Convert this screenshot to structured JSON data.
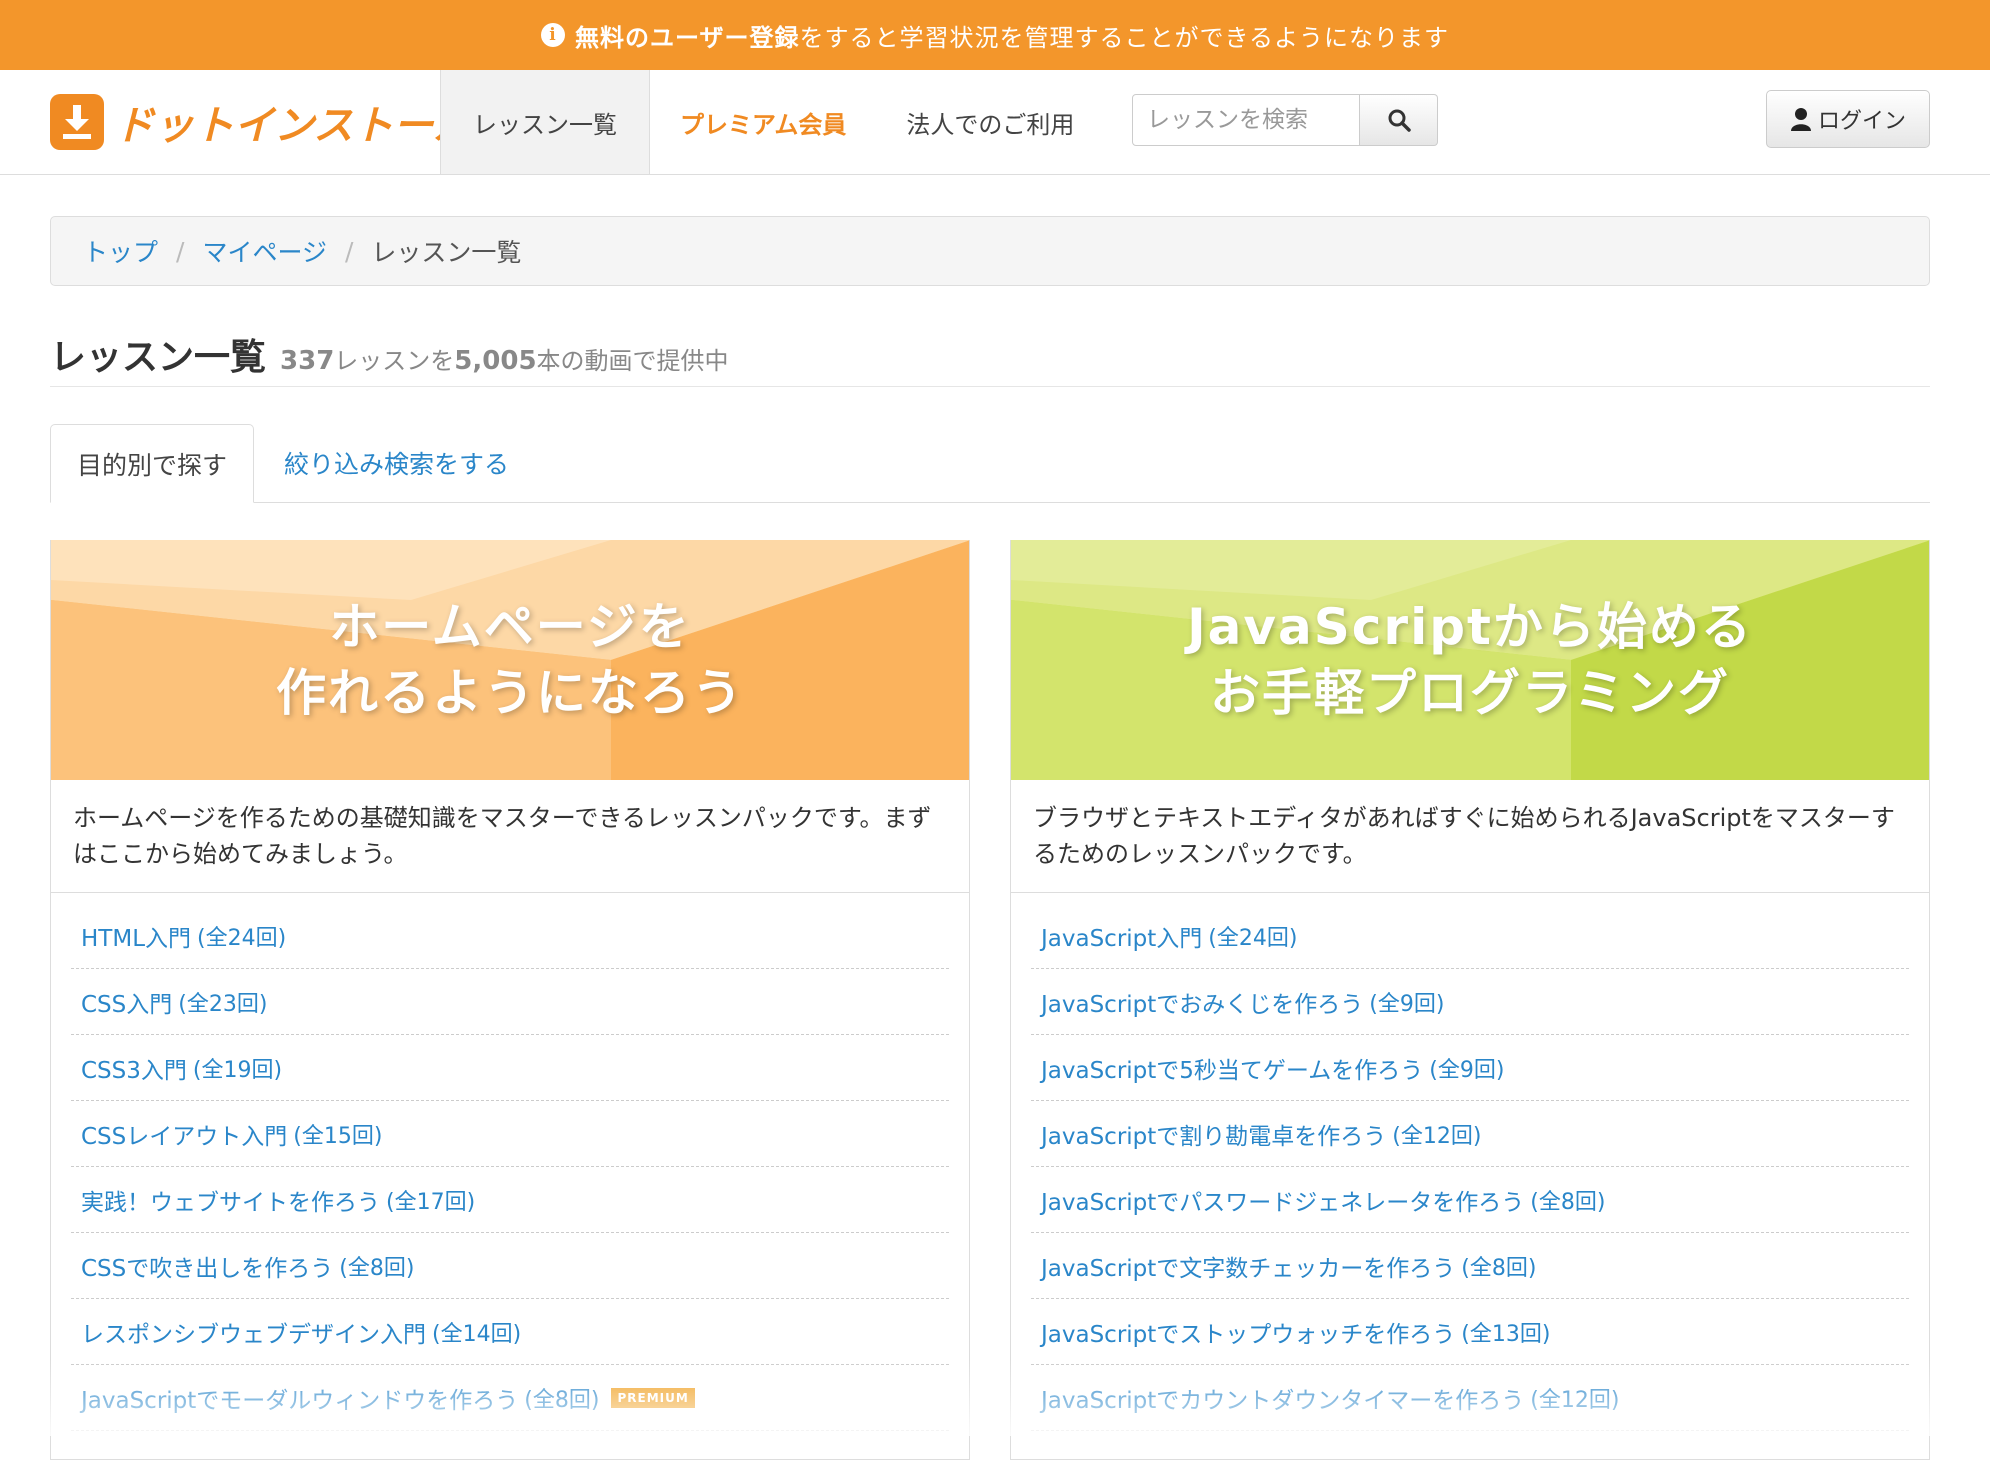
{
  "banner": {
    "strong": "無料のユーザー登録",
    "rest": "をすると学習状況を管理することができるようになります"
  },
  "header": {
    "logo_text": "ドットインストール",
    "nav": [
      {
        "label": "レッスン一覧"
      },
      {
        "label": "プレミアム会員"
      },
      {
        "label": "法人でのご利用"
      }
    ],
    "search_placeholder": "レッスンを検索",
    "login_label": "ログイン"
  },
  "breadcrumb": {
    "items": [
      "トップ",
      "マイページ",
      "レッスン一覧"
    ],
    "separator": "/"
  },
  "page": {
    "title": "レッスン一覧",
    "lesson_count": "337",
    "lesson_count_suffix": "レッスンを",
    "video_count": "5,005",
    "video_count_suffix": "本の動画で提供中"
  },
  "tabs": [
    {
      "label": "目的別で探す"
    },
    {
      "label": "絞り込み検索をする"
    }
  ],
  "packs": [
    {
      "hero_line1": "ホームページを",
      "hero_line2": "作れるようになろう",
      "description": "ホームページを作るための基礎知識をマスターできるレッスンパックです。まずはここから始めてみましょう。",
      "lessons": [
        {
          "title": "HTML入門",
          "count": "(全24回)"
        },
        {
          "title": "CSS入門",
          "count": "(全23回)"
        },
        {
          "title": "CSS3入門",
          "count": "(全19回)"
        },
        {
          "title": "CSSレイアウト入門",
          "count": "(全15回)"
        },
        {
          "title": "実践！ウェブサイトを作ろう",
          "count": "(全17回)"
        },
        {
          "title": "CSSで吹き出しを作ろう",
          "count": "(全8回)"
        },
        {
          "title": "レスポンシブウェブデザイン入門",
          "count": "(全14回)"
        },
        {
          "title": "JavaScriptでモーダルウィンドウを作ろう",
          "count": "(全8回)",
          "badge": "PREMIUM"
        }
      ]
    },
    {
      "hero_line1": "JavaScriptから始める",
      "hero_line2": "お手軽プログラミング",
      "description": "ブラウザとテキストエディタがあればすぐに始められるJavaScriptをマスターするためのレッスンパックです。",
      "lessons": [
        {
          "title": "JavaScript入門",
          "count": "(全24回)"
        },
        {
          "title": "JavaScriptでおみくじを作ろう",
          "count": "(全9回)"
        },
        {
          "title": "JavaScriptで5秒当てゲームを作ろう",
          "count": "(全9回)"
        },
        {
          "title": "JavaScriptで割り勘電卓を作ろう",
          "count": "(全12回)"
        },
        {
          "title": "JavaScriptでパスワードジェネレータを作ろう",
          "count": "(全8回)"
        },
        {
          "title": "JavaScriptで文字数チェッカーを作ろう",
          "count": "(全8回)"
        },
        {
          "title": "JavaScriptでストップウォッチを作ろう",
          "count": "(全13回)"
        },
        {
          "title": "JavaScriptでカウントダウンタイマーを作ろう",
          "count": "(全12回)"
        }
      ]
    }
  ],
  "colors": {
    "brand_orange": "#f3962b",
    "link_blue": "#2a86c9",
    "hero_orange": "#fbbd6e",
    "hero_green": "#cbe05a"
  }
}
